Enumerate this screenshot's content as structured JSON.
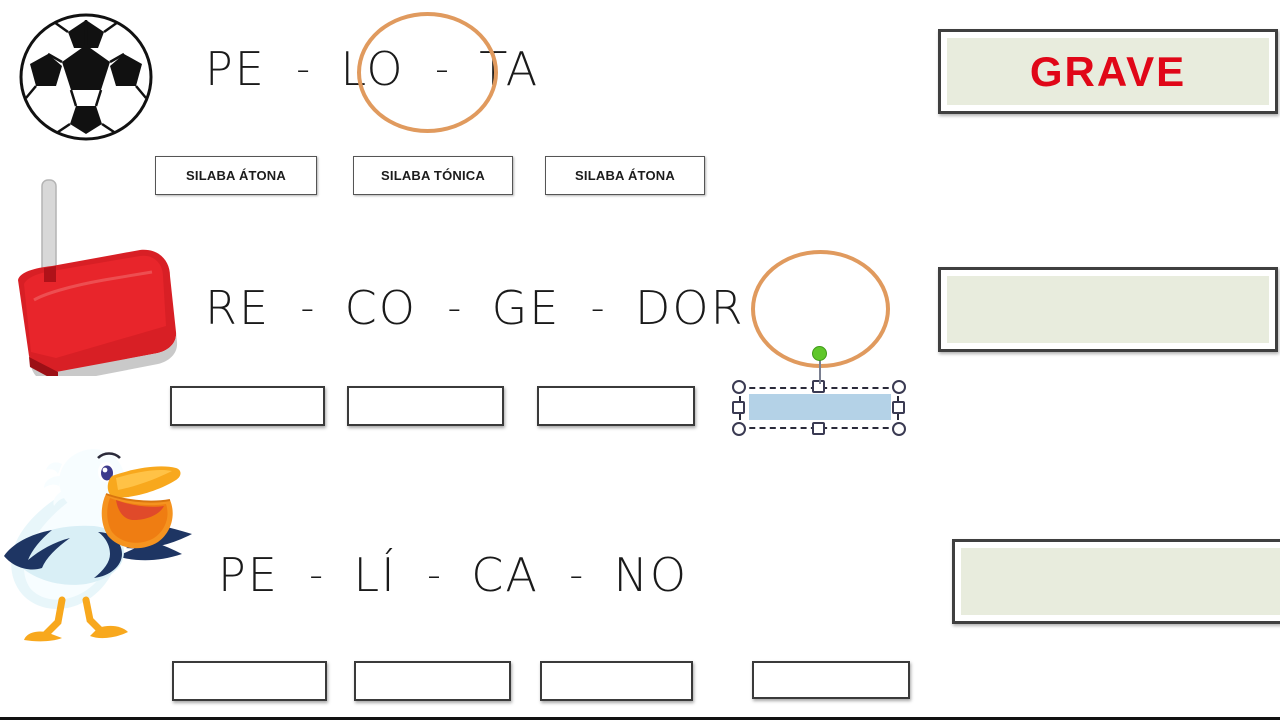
{
  "slide": {
    "background_color": "#ffffff",
    "accent_circle_color": "#e09a5e",
    "panel_fill_color": "#e8ecdd",
    "answer_word_color": "#e00718",
    "selected_shape_fill": "#b4d2e7"
  },
  "rows": [
    {
      "id": "row-pelota",
      "picture": "soccer-ball-image",
      "word": "PELOTA",
      "syllables": [
        "PE",
        "LO",
        "TA"
      ],
      "separator": "-",
      "stressed_index": 1,
      "labels": [
        "SILABA ÁTONA",
        "SILABA TÓNICA",
        "SILABA ÁTONA"
      ],
      "answer_label": "GRAVE"
    },
    {
      "id": "row-recogedor",
      "picture": "dustpan-image",
      "word": "RECOGEDOR",
      "syllables": [
        "RE",
        "CO",
        "GE",
        "DOR"
      ],
      "separator": "-",
      "stressed_index": 3,
      "labels": [
        "",
        "",
        "",
        ""
      ],
      "answer_label": ""
    },
    {
      "id": "row-pelicano",
      "picture": "pelican-image",
      "word": "PELÍCANO",
      "syllables": [
        "PE",
        "LÍ",
        "CA",
        "NO"
      ],
      "separator": "-",
      "stressed_index": 1,
      "labels": [
        "",
        "",
        "",
        ""
      ],
      "answer_label": ""
    }
  ],
  "selection": {
    "shape_name": "answer-box-recogedor-4",
    "state": "selected",
    "rotation_handle": "rotate-handle"
  }
}
